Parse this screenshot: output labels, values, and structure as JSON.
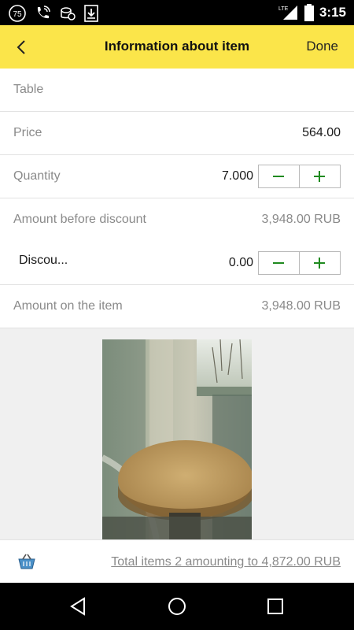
{
  "status_bar": {
    "time": "3:15",
    "network": "LTE",
    "notification_badge": "75",
    "icons": [
      "sync-badge-icon",
      "phone-wifi-icon",
      "coins-icon",
      "download-icon",
      "signal-icon",
      "battery-icon"
    ]
  },
  "header": {
    "title": "Information about item",
    "done_label": "Done",
    "background": "#fbe54a"
  },
  "fields": {
    "name": {
      "label": "Table"
    },
    "price": {
      "label": "Price",
      "value": "564.00"
    },
    "quantity": {
      "label": "Quantity",
      "value": "7.000"
    },
    "amount_before_discount": {
      "label": "Amount before discount",
      "value": "3,948.00 RUB"
    },
    "discount": {
      "label": "Discou...",
      "value": "0.00"
    },
    "amount_on_item": {
      "label": "Amount on the item",
      "value": "3,948.00 RUB"
    }
  },
  "footer": {
    "total_label": "Total items 2 amounting to 4,872.00 RUB"
  },
  "colors": {
    "accent_green": "#1f8a1f",
    "muted_text": "#8a8a8a"
  }
}
